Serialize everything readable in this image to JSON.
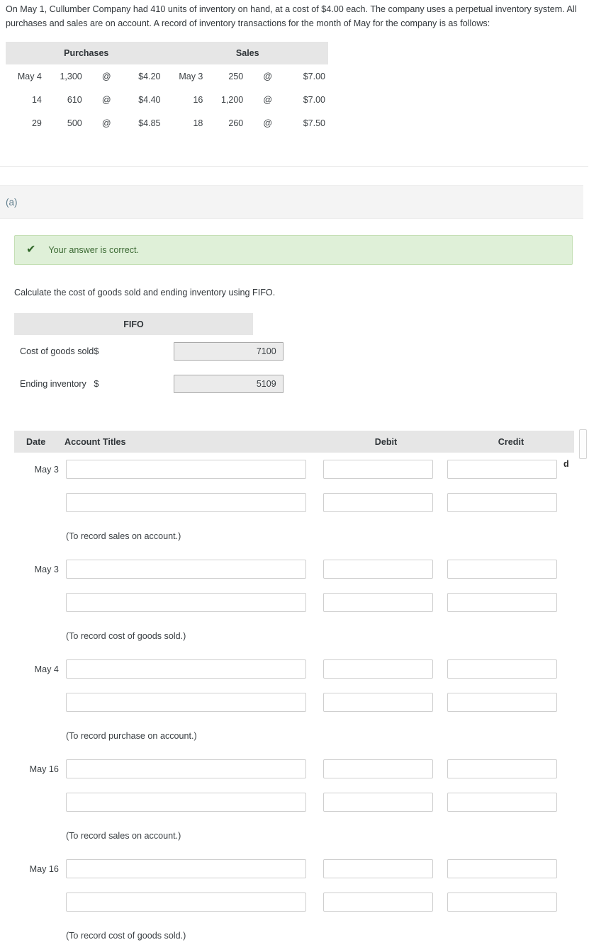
{
  "intro": {
    "text": "On May 1, Cullumber Company had 410 units of inventory on hand, at a cost of $4.00 each. The company uses a perpetual inventory system. All purchases and sales are on account. A record of inventory transactions for the month of May for the company is as follows:"
  },
  "transactions": {
    "headers": [
      "Purchases",
      "Sales"
    ],
    "rows": [
      {
        "purchase_date": "May 4",
        "purchase_qty": "1,300",
        "purchase_at": "@",
        "purchase_price": "$4.20",
        "sale_date": "May 3",
        "sale_qty": "250",
        "sale_at": "@",
        "sale_price": "$7.00"
      },
      {
        "purchase_date": "14",
        "purchase_qty": "610",
        "purchase_at": "@",
        "purchase_price": "$4.40",
        "sale_date": "16",
        "sale_qty": "1,200",
        "sale_at": "@",
        "sale_price": "$7.00"
      },
      {
        "purchase_date": "29",
        "purchase_qty": "500",
        "purchase_at": "@",
        "purchase_price": "$4.85",
        "sale_date": "18",
        "sale_qty": "260",
        "sale_at": "@",
        "sale_price": "$7.50"
      }
    ]
  },
  "part": {
    "label": "(a)"
  },
  "banner": {
    "icon": "check-icon",
    "text": "Your answer is correct.",
    "background_color": "#dff0d8",
    "border_color": "#c4dfb4",
    "text_color": "#3c6a34"
  },
  "fifo_section": {
    "instruction": "Calculate the cost of goods sold and ending inventory using FIFO.",
    "column_header": "FIFO",
    "rows": [
      {
        "label": "Cost of goods sold",
        "currency": "$",
        "value": "7100"
      },
      {
        "label": "Ending inventory",
        "currency": "$",
        "value": "5109"
      }
    ]
  },
  "journal": {
    "headers": {
      "date": "Date",
      "account_titles": "Account Titles",
      "debit": "Debit",
      "credit": "Credit"
    },
    "clipped_text": "d",
    "entries": [
      {
        "date": "May 3",
        "lines": [
          {
            "account": "",
            "debit": "",
            "credit": ""
          },
          {
            "account": "",
            "debit": "",
            "credit": ""
          }
        ],
        "memo": "(To record sales on account.)"
      },
      {
        "date": "May 3",
        "lines": [
          {
            "account": "",
            "debit": "",
            "credit": ""
          },
          {
            "account": "",
            "debit": "",
            "credit": ""
          }
        ],
        "memo": "(To record cost of goods sold.)"
      },
      {
        "date": "May 4",
        "lines": [
          {
            "account": "",
            "debit": "",
            "credit": ""
          },
          {
            "account": "",
            "debit": "",
            "credit": ""
          }
        ],
        "memo": "(To record purchase on account.)"
      },
      {
        "date": "May 16",
        "lines": [
          {
            "account": "",
            "debit": "",
            "credit": ""
          },
          {
            "account": "",
            "debit": "",
            "credit": ""
          }
        ],
        "memo": "(To record sales on account.)"
      },
      {
        "date": "May 16",
        "lines": [
          {
            "account": "",
            "debit": "",
            "credit": ""
          },
          {
            "account": "",
            "debit": "",
            "credit": ""
          }
        ],
        "memo": "(To record cost of goods sold.)"
      }
    ]
  }
}
